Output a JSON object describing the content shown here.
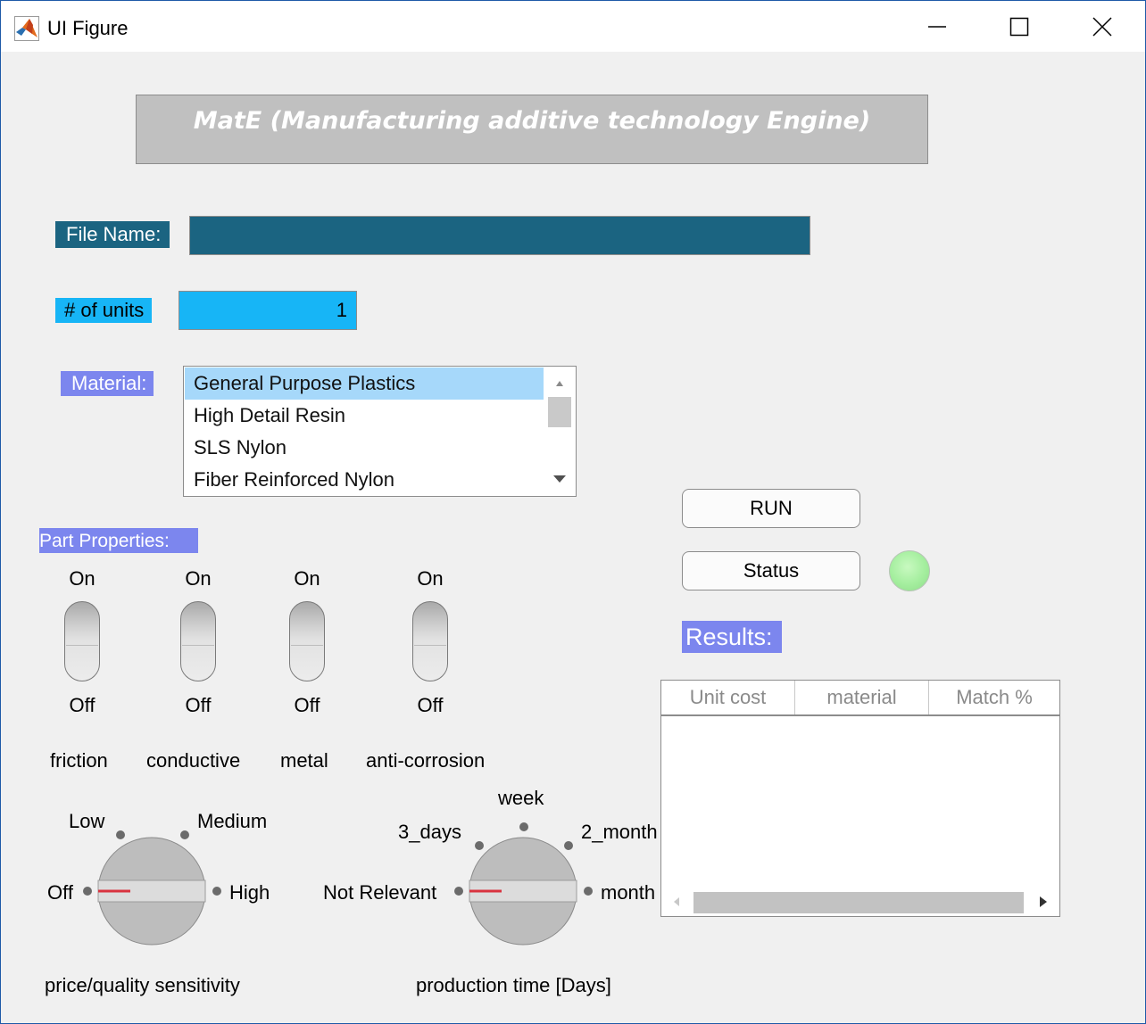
{
  "window": {
    "title": "UI Figure",
    "controls": [
      "minimize-icon",
      "maximize-icon",
      "close-icon"
    ]
  },
  "header": {
    "title": "MatE (Manufacturing additive technology Engine)"
  },
  "file": {
    "label": "File Name:",
    "value": ""
  },
  "units": {
    "label": "# of units",
    "value": "1"
  },
  "material": {
    "label": "Material:",
    "options": [
      "General Purpose Plastics",
      "High Detail Resin",
      "SLS Nylon",
      "Fiber Reinforced Nylon"
    ],
    "selected": "General Purpose Plastics"
  },
  "part_properties": {
    "label": "Part Properties:",
    "switches": [
      {
        "name": "friction",
        "on_label": "On",
        "off_label": "Off",
        "state": "Off"
      },
      {
        "name": "conductive",
        "on_label": "On",
        "off_label": "Off",
        "state": "Off"
      },
      {
        "name": "metal",
        "on_label": "On",
        "off_label": "Off",
        "state": "Off"
      },
      {
        "name": "anti-corrosion",
        "on_label": "On",
        "off_label": "Off",
        "state": "Off"
      }
    ]
  },
  "price_knob": {
    "label": "price/quality sensitivity",
    "positions": [
      "Off",
      "Low",
      "Medium",
      "High"
    ],
    "value": "Off"
  },
  "time_knob": {
    "label": "production time [Days]",
    "positions": [
      "Not Relevant",
      "3_days",
      "week",
      "2_month",
      "month"
    ],
    "value": "Not Relevant"
  },
  "actions": {
    "run_label": "RUN",
    "status_label": "Status"
  },
  "status_lamp": {
    "color": "#a4ee9e"
  },
  "results": {
    "label": "Results:",
    "columns": [
      "Unit cost",
      "material",
      "Match %"
    ],
    "rows": []
  },
  "colors": {
    "file_bg": "#1b6481",
    "units_bg": "#17b5f6",
    "label_bg": "#7c86ee",
    "header_bg": "#c0c0c0",
    "listbox_selected": "#a6d8fa",
    "knob_indicator": "#d9333f"
  }
}
